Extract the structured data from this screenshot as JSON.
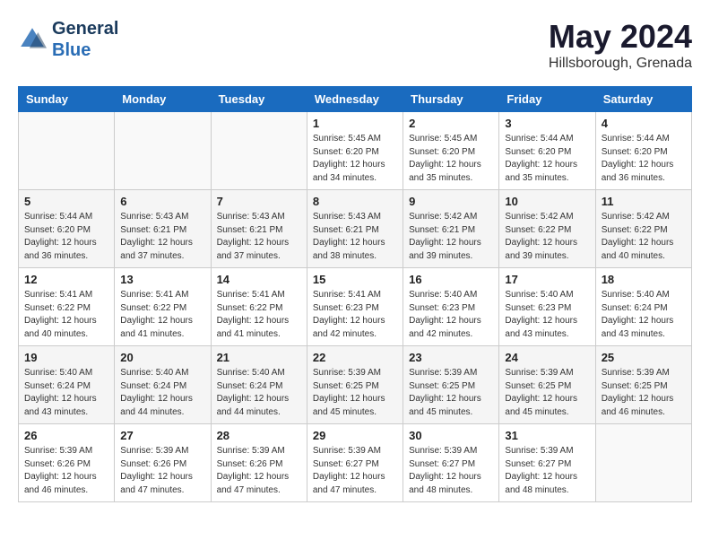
{
  "header": {
    "logo_line1": "General",
    "logo_line2": "Blue",
    "month_year": "May 2024",
    "location": "Hillsborough, Grenada"
  },
  "days_of_week": [
    "Sunday",
    "Monday",
    "Tuesday",
    "Wednesday",
    "Thursday",
    "Friday",
    "Saturday"
  ],
  "weeks": [
    [
      {
        "day": "",
        "sunrise": "",
        "sunset": "",
        "daylight": ""
      },
      {
        "day": "",
        "sunrise": "",
        "sunset": "",
        "daylight": ""
      },
      {
        "day": "",
        "sunrise": "",
        "sunset": "",
        "daylight": ""
      },
      {
        "day": "1",
        "sunrise": "Sunrise: 5:45 AM",
        "sunset": "Sunset: 6:20 PM",
        "daylight": "Daylight: 12 hours and 34 minutes."
      },
      {
        "day": "2",
        "sunrise": "Sunrise: 5:45 AM",
        "sunset": "Sunset: 6:20 PM",
        "daylight": "Daylight: 12 hours and 35 minutes."
      },
      {
        "day": "3",
        "sunrise": "Sunrise: 5:44 AM",
        "sunset": "Sunset: 6:20 PM",
        "daylight": "Daylight: 12 hours and 35 minutes."
      },
      {
        "day": "4",
        "sunrise": "Sunrise: 5:44 AM",
        "sunset": "Sunset: 6:20 PM",
        "daylight": "Daylight: 12 hours and 36 minutes."
      }
    ],
    [
      {
        "day": "5",
        "sunrise": "Sunrise: 5:44 AM",
        "sunset": "Sunset: 6:20 PM",
        "daylight": "Daylight: 12 hours and 36 minutes."
      },
      {
        "day": "6",
        "sunrise": "Sunrise: 5:43 AM",
        "sunset": "Sunset: 6:21 PM",
        "daylight": "Daylight: 12 hours and 37 minutes."
      },
      {
        "day": "7",
        "sunrise": "Sunrise: 5:43 AM",
        "sunset": "Sunset: 6:21 PM",
        "daylight": "Daylight: 12 hours and 37 minutes."
      },
      {
        "day": "8",
        "sunrise": "Sunrise: 5:43 AM",
        "sunset": "Sunset: 6:21 PM",
        "daylight": "Daylight: 12 hours and 38 minutes."
      },
      {
        "day": "9",
        "sunrise": "Sunrise: 5:42 AM",
        "sunset": "Sunset: 6:21 PM",
        "daylight": "Daylight: 12 hours and 39 minutes."
      },
      {
        "day": "10",
        "sunrise": "Sunrise: 5:42 AM",
        "sunset": "Sunset: 6:22 PM",
        "daylight": "Daylight: 12 hours and 39 minutes."
      },
      {
        "day": "11",
        "sunrise": "Sunrise: 5:42 AM",
        "sunset": "Sunset: 6:22 PM",
        "daylight": "Daylight: 12 hours and 40 minutes."
      }
    ],
    [
      {
        "day": "12",
        "sunrise": "Sunrise: 5:41 AM",
        "sunset": "Sunset: 6:22 PM",
        "daylight": "Daylight: 12 hours and 40 minutes."
      },
      {
        "day": "13",
        "sunrise": "Sunrise: 5:41 AM",
        "sunset": "Sunset: 6:22 PM",
        "daylight": "Daylight: 12 hours and 41 minutes."
      },
      {
        "day": "14",
        "sunrise": "Sunrise: 5:41 AM",
        "sunset": "Sunset: 6:22 PM",
        "daylight": "Daylight: 12 hours and 41 minutes."
      },
      {
        "day": "15",
        "sunrise": "Sunrise: 5:41 AM",
        "sunset": "Sunset: 6:23 PM",
        "daylight": "Daylight: 12 hours and 42 minutes."
      },
      {
        "day": "16",
        "sunrise": "Sunrise: 5:40 AM",
        "sunset": "Sunset: 6:23 PM",
        "daylight": "Daylight: 12 hours and 42 minutes."
      },
      {
        "day": "17",
        "sunrise": "Sunrise: 5:40 AM",
        "sunset": "Sunset: 6:23 PM",
        "daylight": "Daylight: 12 hours and 43 minutes."
      },
      {
        "day": "18",
        "sunrise": "Sunrise: 5:40 AM",
        "sunset": "Sunset: 6:24 PM",
        "daylight": "Daylight: 12 hours and 43 minutes."
      }
    ],
    [
      {
        "day": "19",
        "sunrise": "Sunrise: 5:40 AM",
        "sunset": "Sunset: 6:24 PM",
        "daylight": "Daylight: 12 hours and 43 minutes."
      },
      {
        "day": "20",
        "sunrise": "Sunrise: 5:40 AM",
        "sunset": "Sunset: 6:24 PM",
        "daylight": "Daylight: 12 hours and 44 minutes."
      },
      {
        "day": "21",
        "sunrise": "Sunrise: 5:40 AM",
        "sunset": "Sunset: 6:24 PM",
        "daylight": "Daylight: 12 hours and 44 minutes."
      },
      {
        "day": "22",
        "sunrise": "Sunrise: 5:39 AM",
        "sunset": "Sunset: 6:25 PM",
        "daylight": "Daylight: 12 hours and 45 minutes."
      },
      {
        "day": "23",
        "sunrise": "Sunrise: 5:39 AM",
        "sunset": "Sunset: 6:25 PM",
        "daylight": "Daylight: 12 hours and 45 minutes."
      },
      {
        "day": "24",
        "sunrise": "Sunrise: 5:39 AM",
        "sunset": "Sunset: 6:25 PM",
        "daylight": "Daylight: 12 hours and 45 minutes."
      },
      {
        "day": "25",
        "sunrise": "Sunrise: 5:39 AM",
        "sunset": "Sunset: 6:25 PM",
        "daylight": "Daylight: 12 hours and 46 minutes."
      }
    ],
    [
      {
        "day": "26",
        "sunrise": "Sunrise: 5:39 AM",
        "sunset": "Sunset: 6:26 PM",
        "daylight": "Daylight: 12 hours and 46 minutes."
      },
      {
        "day": "27",
        "sunrise": "Sunrise: 5:39 AM",
        "sunset": "Sunset: 6:26 PM",
        "daylight": "Daylight: 12 hours and 47 minutes."
      },
      {
        "day": "28",
        "sunrise": "Sunrise: 5:39 AM",
        "sunset": "Sunset: 6:26 PM",
        "daylight": "Daylight: 12 hours and 47 minutes."
      },
      {
        "day": "29",
        "sunrise": "Sunrise: 5:39 AM",
        "sunset": "Sunset: 6:27 PM",
        "daylight": "Daylight: 12 hours and 47 minutes."
      },
      {
        "day": "30",
        "sunrise": "Sunrise: 5:39 AM",
        "sunset": "Sunset: 6:27 PM",
        "daylight": "Daylight: 12 hours and 48 minutes."
      },
      {
        "day": "31",
        "sunrise": "Sunrise: 5:39 AM",
        "sunset": "Sunset: 6:27 PM",
        "daylight": "Daylight: 12 hours and 48 minutes."
      },
      {
        "day": "",
        "sunrise": "",
        "sunset": "",
        "daylight": ""
      }
    ]
  ]
}
